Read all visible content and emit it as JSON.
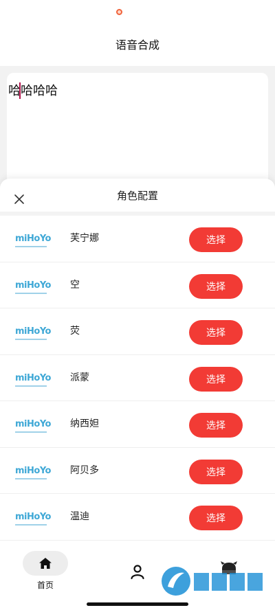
{
  "header": {
    "title": "语音合成"
  },
  "editor": {
    "text": "哈哈哈哈"
  },
  "sheet": {
    "title": "角色配置",
    "characters": [
      {
        "logo": "miHoYo",
        "name": "芙宁娜",
        "button": "选择"
      },
      {
        "logo": "miHoYo",
        "name": "空",
        "button": "选择"
      },
      {
        "logo": "miHoYo",
        "name": "荧",
        "button": "选择"
      },
      {
        "logo": "miHoYo",
        "name": "派蒙",
        "button": "选择"
      },
      {
        "logo": "miHoYo",
        "name": "纳西妲",
        "button": "选择"
      },
      {
        "logo": "miHoYo",
        "name": "阿贝多",
        "button": "选择"
      },
      {
        "logo": "miHoYo",
        "name": "温迪",
        "button": "选择"
      }
    ]
  },
  "tabbar": {
    "home_label": "首页",
    "icons": [
      "home-icon",
      "user-icon",
      "game-icon"
    ]
  },
  "colors": {
    "accent": "#f23b35",
    "logo": "#3fa8d6"
  }
}
